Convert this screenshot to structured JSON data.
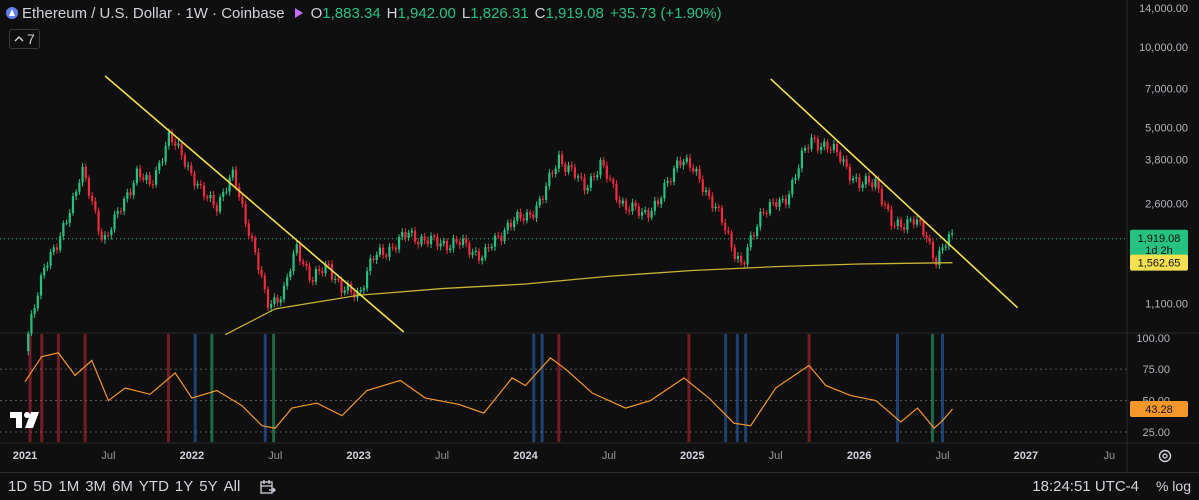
{
  "header": {
    "symbol_title": "Ethereum / U.S. Dollar · 1W · Coinbase",
    "open_label": "O",
    "open": "1,883.34",
    "high_label": "H",
    "high": "1,942.00",
    "low_label": "L",
    "low": "1,826.31",
    "close_label": "C",
    "close": "1,919.08",
    "change": "+35.73 (+1.90%)"
  },
  "indicator_counter": "7",
  "timeframes": [
    "1D",
    "5D",
    "1M",
    "3M",
    "6M",
    "YTD",
    "1Y",
    "5Y",
    "All"
  ],
  "clock": "18:24:51 UTC-4",
  "clock_controls": "%  log",
  "colors": {
    "background": "#0f0f0f",
    "up": "#26c281",
    "down": "#ef2b3d",
    "trendline": "#f5e04f",
    "ma": "#c9b337",
    "oscillator": "#f4962a",
    "price_badge": "#26c281",
    "ma_badge": "#f5e04f",
    "osc_badge": "#f4962a"
  },
  "icons": [
    "ethereum-icon",
    "lightning-mark-icon",
    "collapse-icon",
    "goto-date-icon",
    "settings-gear-icon",
    "tradingview-logo-icon"
  ],
  "chart_data": [
    {
      "type": "candlestick",
      "title": "Ethereum / U.S. Dollar · 1W · Coinbase",
      "y_scale": "log",
      "x_tick_labels": [
        "2021",
        "Jul",
        "2022",
        "Jul",
        "2023",
        "Jul",
        "2024",
        "Jul",
        "2025",
        "Jul",
        "2026",
        "Jul",
        "2027",
        "Ju"
      ],
      "y_tick_labels": [
        "14,000.00",
        "10,000.00",
        "7,000.00",
        "5,000.00",
        "3,800.00",
        "2,600.00",
        "1,919.08",
        "1,100.00"
      ],
      "y_ticks": [
        14000,
        10000,
        7000,
        5000,
        3800,
        2600,
        1919.08,
        1100
      ],
      "ylim": [
        860,
        15000
      ],
      "price_path": [
        {
          "t": 2021.0,
          "p": 730
        },
        {
          "t": 2021.12,
          "p": 1600
        },
        {
          "t": 2021.2,
          "p": 1800
        },
        {
          "t": 2021.34,
          "p": 3500
        },
        {
          "t": 2021.4,
          "p": 2600
        },
        {
          "t": 2021.47,
          "p": 1900
        },
        {
          "t": 2021.55,
          "p": 2300
        },
        {
          "t": 2021.67,
          "p": 3400
        },
        {
          "t": 2021.75,
          "p": 3000
        },
        {
          "t": 2021.86,
          "p": 4600
        },
        {
          "t": 2021.96,
          "p": 3800
        },
        {
          "t": 2022.06,
          "p": 2800
        },
        {
          "t": 2022.15,
          "p": 2600
        },
        {
          "t": 2022.25,
          "p": 3300
        },
        {
          "t": 2022.35,
          "p": 2000
        },
        {
          "t": 2022.45,
          "p": 1100
        },
        {
          "t": 2022.55,
          "p": 1200
        },
        {
          "t": 2022.63,
          "p": 1800
        },
        {
          "t": 2022.72,
          "p": 1330
        },
        {
          "t": 2022.82,
          "p": 1550
        },
        {
          "t": 2022.9,
          "p": 1220
        },
        {
          "t": 2023.0,
          "p": 1200
        },
        {
          "t": 2023.08,
          "p": 1600
        },
        {
          "t": 2023.2,
          "p": 1800
        },
        {
          "t": 2023.3,
          "p": 2000
        },
        {
          "t": 2023.45,
          "p": 1850
        },
        {
          "t": 2023.6,
          "p": 1850
        },
        {
          "t": 2023.75,
          "p": 1650
        },
        {
          "t": 2023.9,
          "p": 2200
        },
        {
          "t": 2024.0,
          "p": 2300
        },
        {
          "t": 2024.1,
          "p": 2700
        },
        {
          "t": 2024.2,
          "p": 3900
        },
        {
          "t": 2024.35,
          "p": 3000
        },
        {
          "t": 2024.45,
          "p": 3600
        },
        {
          "t": 2024.6,
          "p": 2500
        },
        {
          "t": 2024.7,
          "p": 2400
        },
        {
          "t": 2024.8,
          "p": 2600
        },
        {
          "t": 2024.92,
          "p": 3900
        },
        {
          "t": 2025.05,
          "p": 3200
        },
        {
          "t": 2025.18,
          "p": 2200
        },
        {
          "t": 2025.3,
          "p": 1500
        },
        {
          "t": 2025.42,
          "p": 2500
        },
        {
          "t": 2025.55,
          "p": 2600
        },
        {
          "t": 2025.65,
          "p": 3800
        },
        {
          "t": 2025.72,
          "p": 4500
        },
        {
          "t": 2025.8,
          "p": 4300
        },
        {
          "t": 2025.9,
          "p": 3800
        },
        {
          "t": 2026.0,
          "p": 3000
        },
        {
          "t": 2026.1,
          "p": 3200
        },
        {
          "t": 2026.2,
          "p": 2100
        },
        {
          "t": 2026.32,
          "p": 2300
        },
        {
          "t": 2026.4,
          "p": 1950
        },
        {
          "t": 2026.46,
          "p": 1620
        },
        {
          "t": 2026.53,
          "p": 1880
        },
        {
          "t": 2026.56,
          "p": 1919
        }
      ],
      "moving_average": [
        {
          "t": 2022.2,
          "p": 840
        },
        {
          "t": 2022.5,
          "p": 1050
        },
        {
          "t": 2023.0,
          "p": 1180
        },
        {
          "t": 2023.5,
          "p": 1250
        },
        {
          "t": 2024.0,
          "p": 1300
        },
        {
          "t": 2024.5,
          "p": 1390
        },
        {
          "t": 2025.0,
          "p": 1460
        },
        {
          "t": 2025.5,
          "p": 1510
        },
        {
          "t": 2026.0,
          "p": 1545
        },
        {
          "t": 2026.56,
          "p": 1562
        }
      ],
      "trendlines": [
        {
          "from": {
            "t": 2021.48,
            "p": 7800
          },
          "to": {
            "t": 2023.27,
            "p": 860
          }
        },
        {
          "from": {
            "t": 2025.47,
            "p": 7600
          },
          "to": {
            "t": 2026.95,
            "p": 1060
          }
        }
      ],
      "last_price_label": "1,919.08",
      "last_price_sublabel": "1d 2h",
      "ma_value_label": "1,562.65"
    },
    {
      "type": "line",
      "y_tick_labels": [
        "100.00",
        "75.00",
        "50.00",
        "25.00"
      ],
      "y_ticks": [
        100,
        75,
        50,
        25
      ],
      "ylim": [
        17,
        103
      ],
      "oscillator": [
        {
          "t": 2021.0,
          "v": 65
        },
        {
          "t": 2021.1,
          "v": 85
        },
        {
          "t": 2021.2,
          "v": 88
        },
        {
          "t": 2021.3,
          "v": 70
        },
        {
          "t": 2021.4,
          "v": 82
        },
        {
          "t": 2021.5,
          "v": 50
        },
        {
          "t": 2021.6,
          "v": 60
        },
        {
          "t": 2021.75,
          "v": 55
        },
        {
          "t": 2021.9,
          "v": 72
        },
        {
          "t": 2022.0,
          "v": 52
        },
        {
          "t": 2022.15,
          "v": 58
        },
        {
          "t": 2022.3,
          "v": 46
        },
        {
          "t": 2022.42,
          "v": 30
        },
        {
          "t": 2022.5,
          "v": 28
        },
        {
          "t": 2022.6,
          "v": 44
        },
        {
          "t": 2022.75,
          "v": 48
        },
        {
          "t": 2022.9,
          "v": 38
        },
        {
          "t": 2023.05,
          "v": 58
        },
        {
          "t": 2023.25,
          "v": 66
        },
        {
          "t": 2023.4,
          "v": 52
        },
        {
          "t": 2023.6,
          "v": 47
        },
        {
          "t": 2023.75,
          "v": 40
        },
        {
          "t": 2023.92,
          "v": 68
        },
        {
          "t": 2024.0,
          "v": 62
        },
        {
          "t": 2024.15,
          "v": 84
        },
        {
          "t": 2024.25,
          "v": 74
        },
        {
          "t": 2024.4,
          "v": 56
        },
        {
          "t": 2024.6,
          "v": 44
        },
        {
          "t": 2024.75,
          "v": 50
        },
        {
          "t": 2024.95,
          "v": 68
        },
        {
          "t": 2025.1,
          "v": 52
        },
        {
          "t": 2025.25,
          "v": 32
        },
        {
          "t": 2025.35,
          "v": 30
        },
        {
          "t": 2025.5,
          "v": 60
        },
        {
          "t": 2025.7,
          "v": 78
        },
        {
          "t": 2025.8,
          "v": 62
        },
        {
          "t": 2025.95,
          "v": 54
        },
        {
          "t": 2026.1,
          "v": 50
        },
        {
          "t": 2026.25,
          "v": 33
        },
        {
          "t": 2026.35,
          "v": 44
        },
        {
          "t": 2026.45,
          "v": 28
        },
        {
          "t": 2026.5,
          "v": 34
        },
        {
          "t": 2026.56,
          "v": 43.28
        }
      ],
      "value_label": "43.28",
      "highlight_bands": [
        {
          "t": 2021.03,
          "c": "red"
        },
        {
          "t": 2021.1,
          "c": "red"
        },
        {
          "t": 2021.2,
          "c": "red"
        },
        {
          "t": 2021.36,
          "c": "red"
        },
        {
          "t": 2021.86,
          "c": "red"
        },
        {
          "t": 2022.02,
          "c": "blue"
        },
        {
          "t": 2022.12,
          "c": "green"
        },
        {
          "t": 2022.44,
          "c": "blue"
        },
        {
          "t": 2022.49,
          "c": "green"
        },
        {
          "t": 2024.05,
          "c": "blue"
        },
        {
          "t": 2024.1,
          "c": "blue"
        },
        {
          "t": 2024.2,
          "c": "red"
        },
        {
          "t": 2024.98,
          "c": "red"
        },
        {
          "t": 2025.2,
          "c": "blue"
        },
        {
          "t": 2025.27,
          "c": "blue"
        },
        {
          "t": 2025.32,
          "c": "blue"
        },
        {
          "t": 2025.7,
          "c": "red"
        },
        {
          "t": 2026.23,
          "c": "blue"
        },
        {
          "t": 2026.44,
          "c": "green"
        },
        {
          "t": 2026.5,
          "c": "blue"
        }
      ]
    }
  ]
}
